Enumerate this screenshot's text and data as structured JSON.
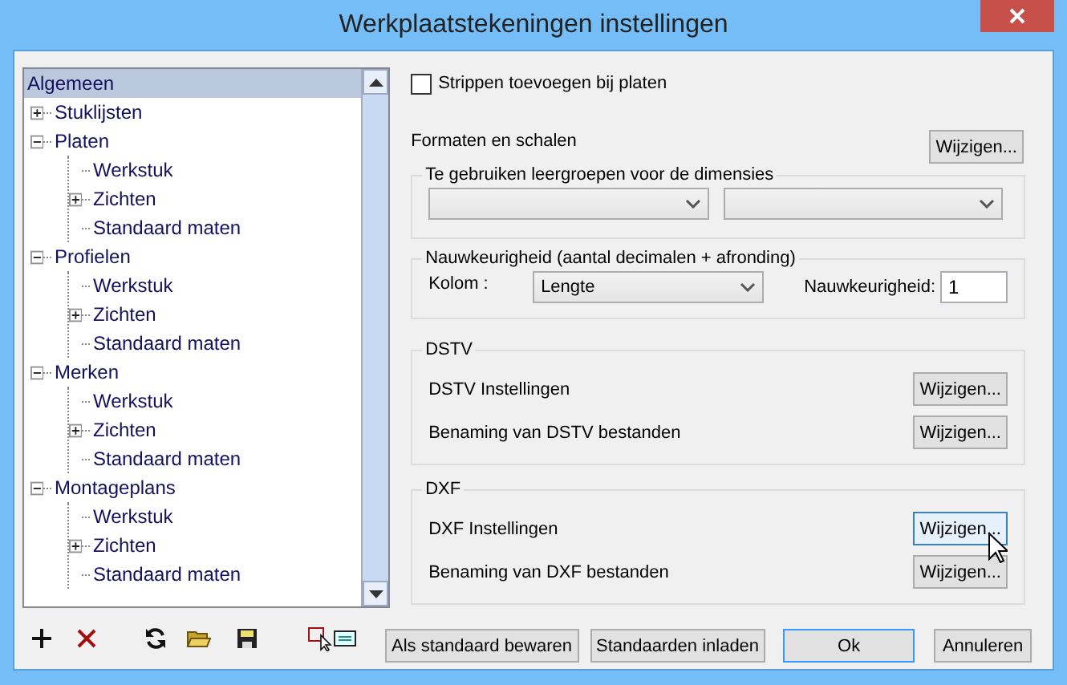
{
  "window": {
    "title": "Werkplaatstekeningen instellingen"
  },
  "tree": [
    {
      "label": "Algemeen",
      "selected": true
    },
    {
      "label": "Stuklijsten",
      "selected": false,
      "expanded": false
    },
    {
      "label": "Platen",
      "selected": false,
      "expanded": true,
      "children": [
        {
          "label": "Werkstuk",
          "selected": false
        },
        {
          "label": "Zichten",
          "selected": false,
          "expanded": false
        },
        {
          "label": "Standaard maten",
          "selected": false
        }
      ]
    },
    {
      "label": "Profielen",
      "selected": false,
      "expanded": true,
      "children": [
        {
          "label": "Werkstuk",
          "selected": false
        },
        {
          "label": "Zichten",
          "selected": false,
          "expanded": false
        },
        {
          "label": "Standaard maten",
          "selected": false
        }
      ]
    },
    {
      "label": "Merken",
      "selected": false,
      "expanded": true,
      "children": [
        {
          "label": "Werkstuk",
          "selected": false
        },
        {
          "label": "Zichten",
          "selected": false,
          "expanded": false
        },
        {
          "label": "Standaard maten",
          "selected": false
        }
      ]
    },
    {
      "label": "Montageplans",
      "selected": false,
      "expanded": true,
      "children": [
        {
          "label": "Werkstuk",
          "selected": false
        },
        {
          "label": "Zichten",
          "selected": false,
          "expanded": false
        },
        {
          "label": "Standaard maten",
          "selected": false
        }
      ]
    }
  ],
  "strips_checkbox": {
    "label": "Strippen toevoegen bij platen",
    "checked": false
  },
  "formats": {
    "label": "Formaten en schalen",
    "button": "Wijzigen..."
  },
  "layer_groups": {
    "title": "Te gebruiken leergroepen voor de dimensies",
    "dropdowns": [
      {
        "kind": "dropdown"
      },
      {
        "kind": "dropdown"
      }
    ]
  },
  "precision": {
    "title": "Nauwkeurigheid (aantal decimalen + afronding)",
    "column_label": "Kolom :",
    "column_value": "Lengte",
    "precision_label": "Nauwkeurigheid:",
    "precision_value": "1"
  },
  "groups": [
    {
      "title": "DSTV",
      "rows": [
        {
          "label": "DSTV Instellingen",
          "button": "Wijzigen...",
          "hovered": false
        },
        {
          "label": "Benaming van DSTV bestanden",
          "button": "Wijzigen...",
          "hovered": false
        }
      ]
    },
    {
      "title": "DXF",
      "rows": [
        {
          "label": "DXF Instellingen",
          "button": "Wijzigen...",
          "hovered": true
        },
        {
          "label": "Benaming van DXF bestanden",
          "button": "Wijzigen...",
          "hovered": false
        }
      ]
    }
  ],
  "toolbar": [
    {
      "kind": "add"
    },
    {
      "kind": "delete"
    },
    {
      "kind": "refresh"
    },
    {
      "kind": "open"
    },
    {
      "kind": "save"
    },
    {
      "kind": "select"
    },
    {
      "kind": "comment"
    }
  ],
  "buttons": [
    {
      "label": "Als standaard bewaren",
      "default": false
    },
    {
      "label": "Standaarden inladen",
      "default": false
    },
    {
      "label": "Ok",
      "default": true
    },
    {
      "label": "Annuleren",
      "default": false
    }
  ]
}
